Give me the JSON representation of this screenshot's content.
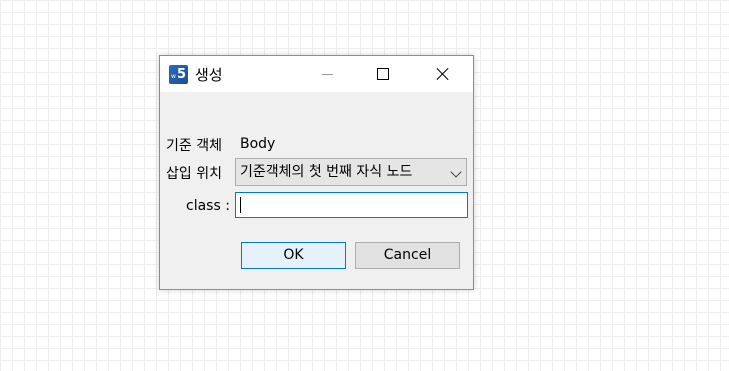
{
  "dialog": {
    "title": "생성",
    "app_icon": "w5-app-icon",
    "controls": {
      "minimize": "minimize-icon",
      "maximize": "maximize-icon",
      "close": "close-icon"
    }
  },
  "form": {
    "base_object_label": "기준 객체",
    "base_object_value": "Body",
    "insert_position_label": "삽입 위치",
    "insert_position_value": "기준객체의 첫 번째 자식 노드",
    "class_label": "class :",
    "class_value": ""
  },
  "buttons": {
    "ok": "OK",
    "cancel": "Cancel"
  },
  "colors": {
    "accent": "#0078d7",
    "dialog_bg": "#f0f0f0",
    "ok_bg": "#e5f1fb"
  }
}
